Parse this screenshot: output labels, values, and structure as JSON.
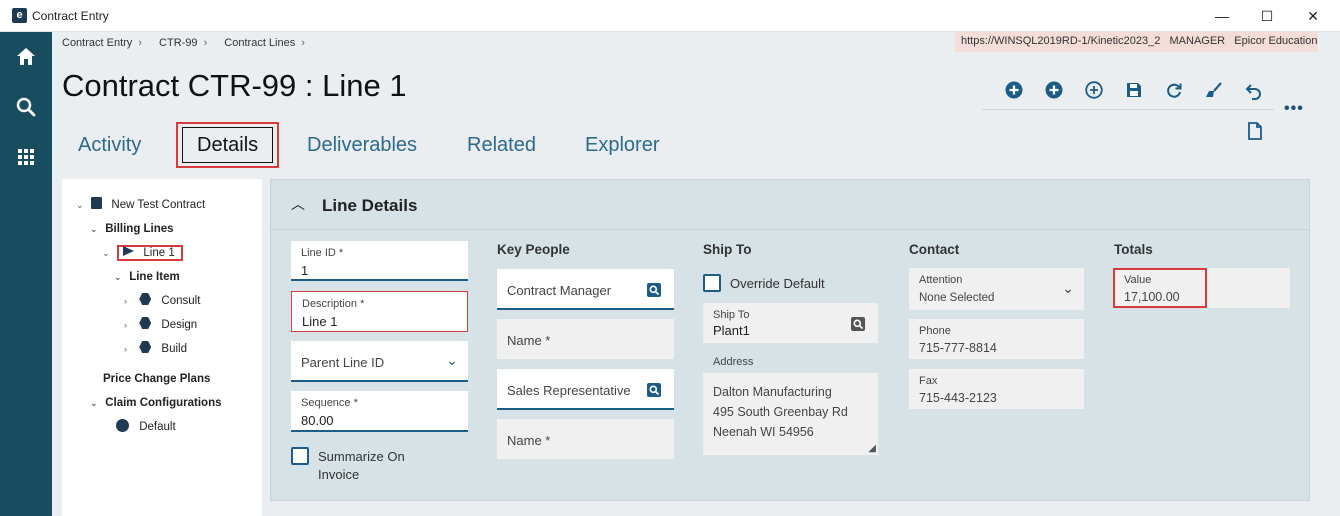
{
  "window": {
    "title": "Contract Entry",
    "logo_letter": "e",
    "min_glyph": "—",
    "max_glyph": "☐",
    "close_glyph": "✕"
  },
  "breadcrumb": {
    "items": [
      "Contract Entry",
      "CTR-99",
      "Contract Lines"
    ],
    "separator": "›"
  },
  "environment": {
    "url": "https://WINSQL2019RD-1/Kinetic2023_2",
    "user": "MANAGER",
    "company": "Epicor Education"
  },
  "page_title": "Contract CTR-99 : Line 1",
  "toolbar": {
    "icons": [
      "add-circle-icon",
      "add-circle-icon",
      "add-outline-icon",
      "save-icon",
      "refresh-icon",
      "clear-icon",
      "undo-icon"
    ],
    "more_label": "•••"
  },
  "tabs": [
    {
      "label": "Activity",
      "active": false
    },
    {
      "label": "Details",
      "active": true
    },
    {
      "label": "Deliverables",
      "active": false
    },
    {
      "label": "Related",
      "active": false
    },
    {
      "label": "Explorer",
      "active": false
    }
  ],
  "tree": {
    "root": "New Test Contract",
    "billing_lines": "Billing Lines",
    "line1": "Line 1",
    "line_item": "Line Item",
    "children": [
      "Consult",
      "Design",
      "Build"
    ],
    "price_change_plans": "Price Change Plans",
    "claim_configurations": "Claim Configurations",
    "default": "Default"
  },
  "panel": {
    "title": "Line Details",
    "line": {
      "line_id_label": "Line ID *",
      "line_id_value": "1",
      "description_label": "Description *",
      "description_value": "Line 1",
      "parent_line_placeholder": "Parent Line ID",
      "sequence_label": "Sequence *",
      "sequence_value": "80.00",
      "summarize_label": "Summarize On Invoice"
    },
    "key_people": {
      "heading": "Key People",
      "contract_manager": "Contract Manager",
      "name_placeholder_1": "Name *",
      "sales_rep": "Sales Representative",
      "name_placeholder_2": "Name *"
    },
    "ship_to": {
      "heading": "Ship To",
      "override_label": "Override Default",
      "ship_to_label": "Ship To",
      "ship_to_value": "Plant1",
      "address_label": "Address",
      "address_lines": [
        "Dalton Manufacturing",
        "495 South Greenbay Rd",
        "Neenah WI 54956"
      ]
    },
    "contact": {
      "heading": "Contact",
      "attention_label": "Attention",
      "attention_value": "None Selected",
      "phone_label": "Phone",
      "phone_value": "715-777-8814",
      "fax_label": "Fax",
      "fax_value": "715-443-2123"
    },
    "totals": {
      "heading": "Totals",
      "value_label": "Value",
      "value": "17,100.00"
    }
  },
  "colors": {
    "rail": "#184d60",
    "accent": "#1c5c86",
    "highlight": "#d63c3c",
    "env_banner": "#f4dcd9"
  }
}
